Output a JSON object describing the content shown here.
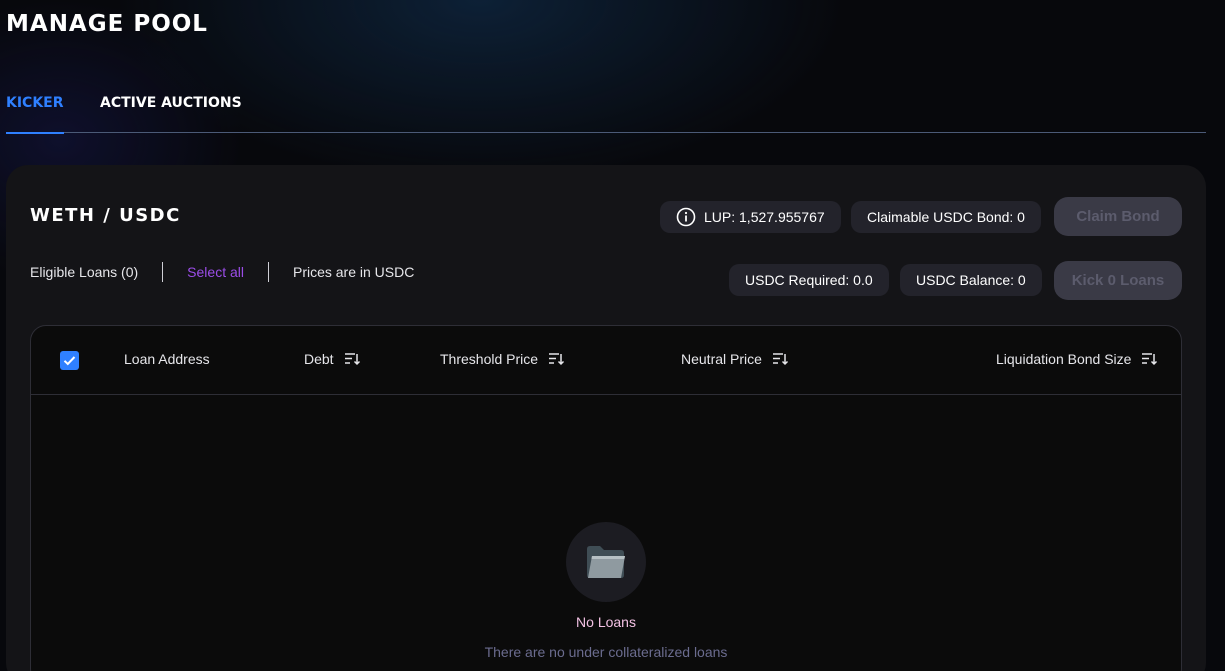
{
  "page": {
    "title": "MANAGE POOL"
  },
  "tabs": [
    {
      "label": "KICKER",
      "active": true
    },
    {
      "label": "ACTIVE AUCTIONS",
      "active": false
    }
  ],
  "pool": {
    "pair": "WETH / USDC",
    "lup": "LUP: 1,527.955767",
    "claimable_bond": "Claimable USDC Bond: 0",
    "claim_button": "Claim Bond",
    "usdc_required": "USDC Required: 0.0",
    "usdc_balance": "USDC Balance: 0",
    "kick_button": "Kick 0 Loans",
    "eligible_loans": "Eligible Loans (0)",
    "select_all": "Select all",
    "prices_note": "Prices are in USDC"
  },
  "table": {
    "columns": [
      "Loan Address",
      "Debt",
      "Threshold Price",
      "Neutral Price",
      "Liquidation Bond Size"
    ],
    "select_all_checked": true,
    "rows": []
  },
  "empty_state": {
    "title": "No Loans",
    "subtitle": "There are no under collateralized loans",
    "icon": "folder-icon"
  },
  "colors": {
    "accent": "#2f80ff",
    "select_link": "#9b4de8",
    "card_bg": "#141417",
    "pill_bg": "#23232b",
    "empty_title": "#f2c1e3"
  }
}
